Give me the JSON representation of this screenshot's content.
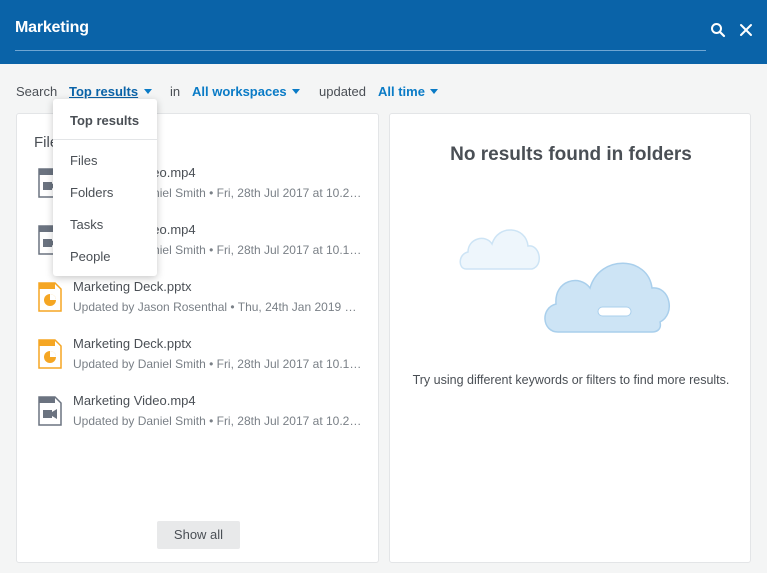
{
  "search": {
    "query": "Marketing"
  },
  "filters": {
    "search_label": "Search",
    "type_value": "Top results",
    "in_label": "in",
    "workspace_value": "All workspaces",
    "updated_label": "updated",
    "time_value": "All time"
  },
  "dropdown": {
    "selected": "Top results",
    "options": [
      "Files",
      "Folders",
      "Tasks",
      "People"
    ]
  },
  "files": {
    "heading": "Files",
    "items": [
      {
        "title": "Marketing Video.mp4",
        "subtitle": "Updated by Daniel Smith • Fri, 28th Jul 2017 at 10.2…",
        "icon": "video-file-icon"
      },
      {
        "title": "Marketing Video.mp4",
        "subtitle": "Updated by Daniel Smith • Fri, 28th Jul 2017 at 10.1…",
        "icon": "video-file-icon"
      },
      {
        "title": "Marketing Deck.pptx",
        "subtitle": "Updated by Jason Rosenthal • Thu, 24th Jan 2019 …",
        "icon": "presentation-file-icon"
      },
      {
        "title": "Marketing Deck.pptx",
        "subtitle": "Updated by Daniel Smith • Fri, 28th Jul 2017 at 10.1…",
        "icon": "presentation-file-icon"
      },
      {
        "title": "Marketing Video.mp4",
        "subtitle": "Updated by Daniel Smith • Fri, 28th Jul 2017 at 10.2…",
        "icon": "video-file-icon"
      }
    ],
    "show_all": "Show all"
  },
  "folders": {
    "empty_title": "No results found in folders",
    "empty_hint": "Try using different keywords or filters to find more results."
  },
  "colors": {
    "header": "#0a63a8",
    "link": "#0a7bc6",
    "video_icon": "#6b7380",
    "ppt_icon": "#f5a623",
    "cloud": "#cde4f5"
  }
}
